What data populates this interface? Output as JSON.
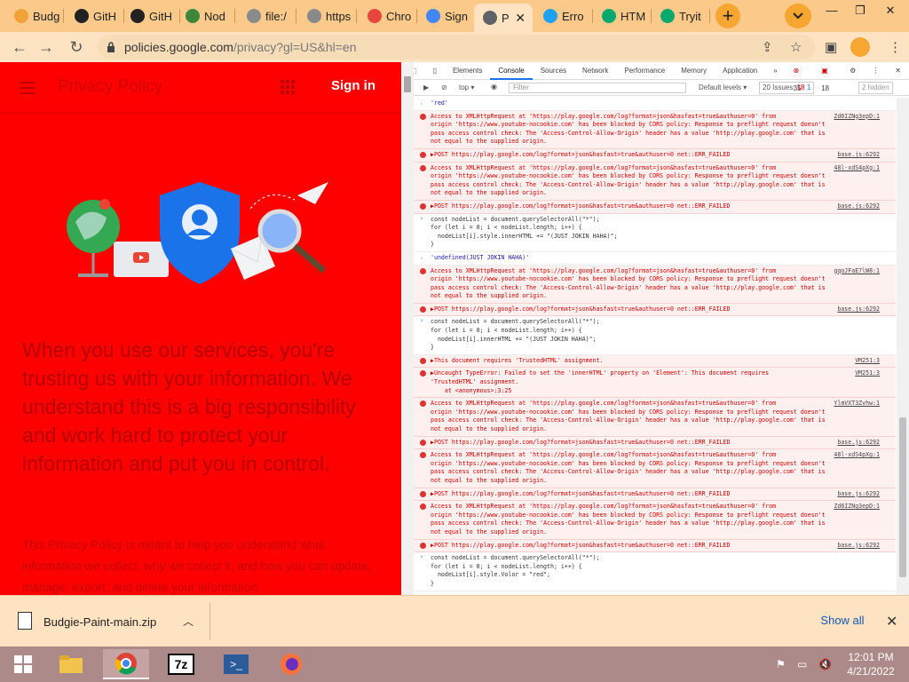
{
  "browser": {
    "tabs": [
      {
        "title": "Budg",
        "color": "#f1a33a"
      },
      {
        "title": "GitH",
        "color": "#222222"
      },
      {
        "title": "GitH",
        "color": "#222222"
      },
      {
        "title": "Nod",
        "color": "#3c873a"
      },
      {
        "title": "file:/",
        "color": "#8a8a8a"
      },
      {
        "title": "https",
        "color": "#8a8a8a"
      },
      {
        "title": "Chro",
        "color": "#e8453c"
      },
      {
        "title": "Sign",
        "color": "#4285f4"
      },
      {
        "title": "P",
        "color": "#5f6368"
      },
      {
        "title": "Erro",
        "color": "#1da1f2"
      },
      {
        "title": "HTM",
        "color": "#04aa6d"
      },
      {
        "title": "Tryit",
        "color": "#04aa6d"
      }
    ],
    "new_tab_label": "+",
    "url_host": "policies.google.com",
    "url_path": "/privacy?gl=US&hl=en"
  },
  "page": {
    "title": "Privacy Policy",
    "signin": "Sign in",
    "headline": "When you use our services, you're trusting us with your information. We understand this is a big responsibility and work hard to protect your information and put you in control.",
    "body": "This Privacy Policy is meant to help you understand what information we collect, why we collect it, and how you can update, manage, export, and delete your information."
  },
  "devtools": {
    "tabs": [
      "Elements",
      "Console",
      "Sources",
      "Network",
      "Performance",
      "Memory",
      "Application"
    ],
    "more": "»",
    "error_count": "35",
    "warn_count": "18",
    "context": "top",
    "filter_placeholder": "Filter",
    "levels": "Default levels",
    "issues": "20 Issues: ",
    "issues_err": "18",
    "issues_info": "1",
    "hidden": "2 hidden",
    "messages": [
      {
        "type": "result",
        "text": "'red'",
        "src": ""
      },
      {
        "type": "err",
        "text": "Access to XMLHttpRequest at 'https://play.google.com/log?format=json&hasfast=true&authuser=0' from\norigin 'https://www.youtube-nocookie.com' has been blocked by CORS policy: Response to preflight request doesn't\npass access control check: The 'Access-Control-Allow-Origin' header has a value 'http://play.google.com' that is\nnot equal to the supplied origin.",
        "src": "Zd6IZNg3epD:1"
      },
      {
        "type": "err",
        "text": "▶POST https://play.google.com/log?format=json&hasfast=true&authuser=0 net::ERR_FAILED",
        "src": "base.js:6292"
      },
      {
        "type": "err",
        "text": "Access to XMLHttpRequest at 'https://play.google.com/log?format=json&hasfast=true&authuser=0' from\norigin 'https://www.youtube-nocookie.com' has been blocked by CORS policy: Response to preflight request doesn't\npass access control check: The 'Access-Control-Allow-Origin' header has a value 'http://play.google.com' that is\nnot equal to the supplied origin.",
        "src": "48l-xdS4pXg:1"
      },
      {
        "type": "err",
        "text": "▶POST https://play.google.com/log?format=json&hasfast=true&authuser=0 net::ERR_FAILED",
        "src": "base.js:6292"
      },
      {
        "type": "input",
        "text": "const nodeList = document.querySelectorAll(\"*\");\nfor (let i = 0; i < nodeList.length; i++) {\n  nodeList[i].style.innerHTML += \"(JUST JOKIN HAHA)\";\n}",
        "src": ""
      },
      {
        "type": "result",
        "text": "'undefined(JUST JOKIN HAHA)'",
        "src": ""
      },
      {
        "type": "err",
        "text": "Access to XMLHttpRequest at 'https://play.google.com/log?format=json&hasfast=true&authuser=0' from\norigin 'https://www.youtube-nocookie.com' has been blocked by CORS policy: Response to preflight request doesn't\npass access control check: The 'Access-Control-Allow-Origin' header has a value 'http://play.google.com' that is\nnot equal to the supplied origin.",
        "src": "gqoJFaE7lW8:1"
      },
      {
        "type": "err",
        "text": "▶POST https://play.google.com/log?format=json&hasfast=true&authuser=0 net::ERR_FAILED",
        "src": "base.js:6292"
      },
      {
        "type": "input",
        "text": "const nodeList = document.querySelectorAll(\"*\");\nfor (let i = 0; i < nodeList.length; i++) {\n  nodeList[i].innerHTML += \"(JUST JOKIN HAHA)\";\n}",
        "src": ""
      },
      {
        "type": "err",
        "text": "▶This document requires 'TrustedHTML' assignment.",
        "src": "VM251:3"
      },
      {
        "type": "err",
        "text": "▶Uncaught TypeError: Failed to set the 'innerHTML' property on 'Element': This document requires\n'TrustedHTML' assignment.\n    at <anonymous>:3:25",
        "src": "VM251:3"
      },
      {
        "type": "err",
        "text": "Access to XMLHttpRequest at 'https://play.google.com/log?format=json&hasfast=true&authuser=0' from\norigin 'https://www.youtube-nocookie.com' has been blocked by CORS policy: Response to preflight request doesn't\npass access control check: The 'Access-Control-Allow-Origin' header has a value 'http://play.google.com' that is\nnot equal to the supplied origin.",
        "src": "YlmVXT3Zvhw:1"
      },
      {
        "type": "err",
        "text": "▶POST https://play.google.com/log?format=json&hasfast=true&authuser=0 net::ERR_FAILED",
        "src": "base.js:6292"
      },
      {
        "type": "err",
        "text": "Access to XMLHttpRequest at 'https://play.google.com/log?format=json&hasfast=true&authuser=0' from\norigin 'https://www.youtube-nocookie.com' has been blocked by CORS policy: Response to preflight request doesn't\npass access control check: The 'Access-Control-Allow-Origin' header has a value 'http://play.google.com' that is\nnot equal to the supplied origin.",
        "src": "48l-xdS4pXg:1"
      },
      {
        "type": "err",
        "text": "▶POST https://play.google.com/log?format=json&hasfast=true&authuser=0 net::ERR_FAILED",
        "src": "base.js:6292"
      },
      {
        "type": "err",
        "text": "Access to XMLHttpRequest at 'https://play.google.com/log?format=json&hasfast=true&authuser=0' from\norigin 'https://www.youtube-nocookie.com' has been blocked by CORS policy: Response to preflight request doesn't\npass access control check: The 'Access-Control-Allow-Origin' header has a value 'http://play.google.com' that is\nnot equal to the supplied origin.",
        "src": "Zd6IZNg3epD:1"
      },
      {
        "type": "err",
        "text": "▶POST https://play.google.com/log?format=json&hasfast=true&authuser=0 net::ERR_FAILED",
        "src": "base.js:6292"
      },
      {
        "type": "input",
        "text": "const nodeList = document.querySelectorAll(\"*\");\nfor (let i = 0; i < nodeList.length; i++) {\n  nodeList[i].style.Volor = \"red\";\n}",
        "src": ""
      }
    ]
  },
  "download": {
    "filename": "Budgie-Paint-main.zip",
    "show_all": "Show all"
  },
  "taskbar": {
    "time": "12:01 PM",
    "date": "4/21/2022"
  },
  "colors": {
    "page_bg": "#fe0000",
    "chrome_frame": "#fbc98a",
    "chrome_toolbar": "#fde3c1",
    "taskbar": "#ad8a8a",
    "accent_blue": "#1a73e8"
  }
}
